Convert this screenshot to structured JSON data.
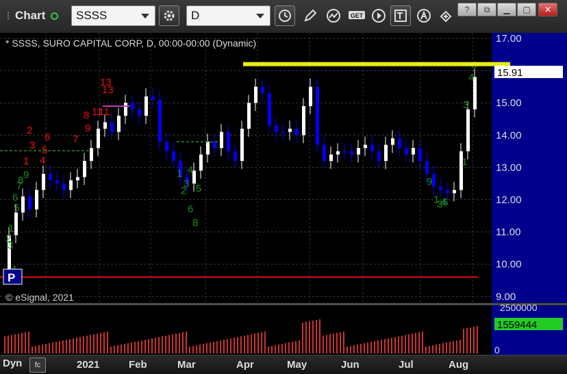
{
  "toolbar": {
    "title": "Chart",
    "symbol": "SSSS",
    "interval": "D"
  },
  "chart": {
    "header": "* SSSS, SURO CAPITAL CORP, D, 00:00-00:00 (Dynamic)",
    "watermark": "© eSignal, 2021",
    "last_price": "15.91",
    "p_marker": "P",
    "volume_last": "1559444",
    "volume_max_label": "2500000",
    "volume_zero_label": "0"
  },
  "footer": {
    "mode": "Dyn",
    "months": [
      "2021",
      "Feb",
      "Mar",
      "Apr",
      "May",
      "Jun",
      "Jul",
      "Aug"
    ]
  },
  "chart_data": {
    "type": "candlestick",
    "y_ticks": [
      "17.00",
      "16.00",
      "15.00",
      "14.00",
      "13.00",
      "12.00",
      "11.00",
      "10.00",
      "9.00"
    ],
    "ylim": [
      9,
      17
    ],
    "annotations": {
      "resistance_line": 16.2,
      "support_line": 9.6,
      "last_price": 15.91
    },
    "colors": {
      "up": "#ffffff",
      "down": "#0000ff",
      "resistance": "#e8ef10",
      "support": "#e01010",
      "count_sell": "#ee1111",
      "count_buy": "#1e8c1e"
    },
    "sell_counts": [
      "1",
      "2",
      "3",
      "4",
      "5",
      "6",
      "7",
      "8",
      "9",
      "11",
      "11",
      "13",
      "13"
    ],
    "buy_counts": [
      "1",
      "2",
      "3",
      "4",
      "5",
      "6",
      "7",
      "8",
      "9",
      "1",
      "2",
      "3",
      "4",
      "5",
      "6",
      "8",
      "1",
      "3",
      "4",
      "6",
      "9",
      "1",
      "3",
      "4",
      "5"
    ]
  }
}
